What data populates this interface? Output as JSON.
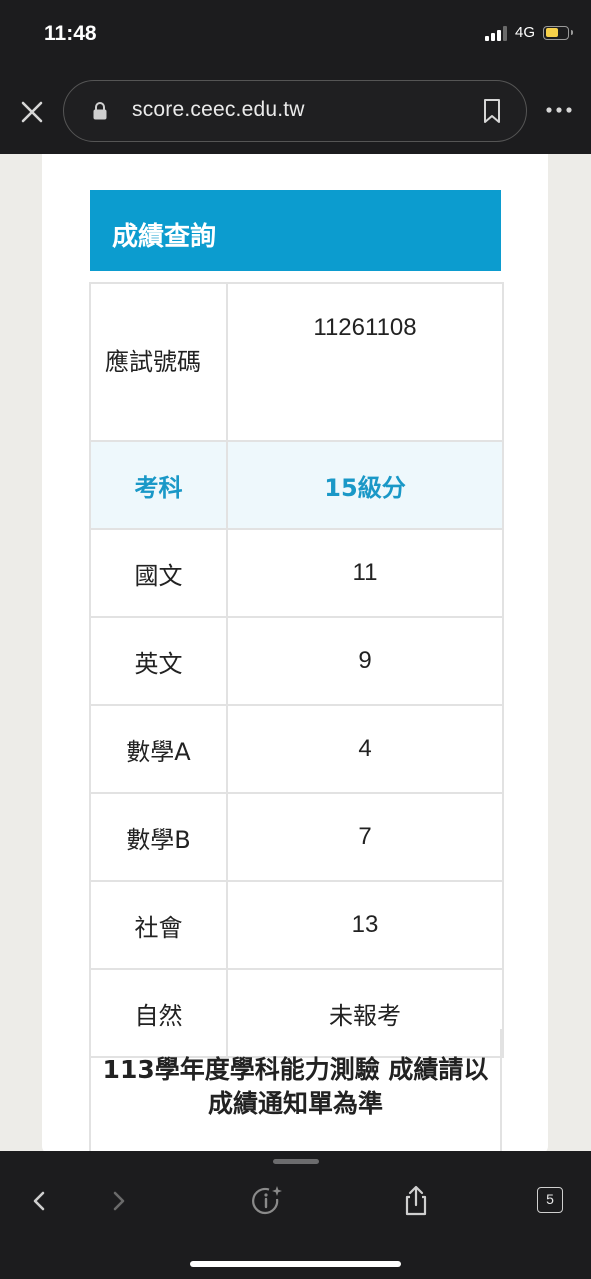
{
  "status_bar": {
    "time": "11:48",
    "network": "4G"
  },
  "browser": {
    "url": "score.ceec.edu.tw",
    "tab_count": "5"
  },
  "panel": {
    "title": "成績查詢"
  },
  "table": {
    "exam_id_label": "應試號碼",
    "exam_id_value": "11261108",
    "header_subject": "考科",
    "header_score": "15級分",
    "rows": [
      {
        "subject": "國文",
        "score": "11"
      },
      {
        "subject": "英文",
        "score": "9"
      },
      {
        "subject": "數學A",
        "score": "4"
      },
      {
        "subject": "數學B",
        "score": "7"
      },
      {
        "subject": "社會",
        "score": "13"
      },
      {
        "subject": "自然",
        "score": "未報考"
      }
    ]
  },
  "note": "113學年度學科能力測驗 成績請以成績通知單為準",
  "colors": {
    "accent": "#0c9ccf",
    "header_bg": "#eef8fc",
    "header_text": "#1a98c7",
    "battery": "#f7d14a"
  },
  "icons": {
    "close": "close-icon",
    "lock": "lock-icon",
    "bookmark": "bookmark-icon",
    "more": "more-icon",
    "back": "chevron-left-icon",
    "forward": "chevron-right-icon",
    "info": "info-sparkle-icon",
    "share": "share-icon",
    "tabs": "tabs-icon"
  }
}
